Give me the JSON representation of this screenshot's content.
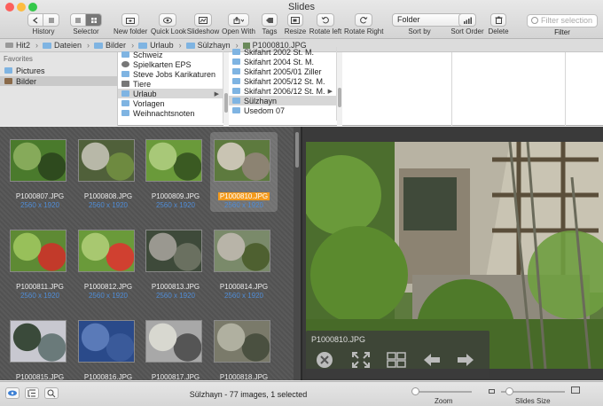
{
  "window": {
    "title": "Slides"
  },
  "toolbar": {
    "history_label": "History",
    "selector_label": "Selector",
    "new_folder_label": "New folder",
    "quick_look_label": "Quick Look",
    "slideshow_label": "Slideshow",
    "open_with_label": "Open With",
    "tags_label": "Tags",
    "resize_label": "Resize",
    "rotate_left_label": "Rotate left",
    "rotate_right_label": "Rotate Right",
    "sort_by_label": "Sort by",
    "sort_by_value": "Folder",
    "sort_order_label": "Sort Order",
    "delete_label": "Delete",
    "filter_label": "Filter",
    "filter_placeholder": "Filter selection"
  },
  "path": {
    "items": [
      "Hit2",
      "Dateien",
      "Bilder",
      "Urlaub",
      "Sülzhayn",
      "P1000810.JPG"
    ]
  },
  "sidebar": {
    "header": "Favorites",
    "items": [
      {
        "label": "Pictures"
      },
      {
        "label": "Bilder"
      }
    ]
  },
  "columns": {
    "col1": [
      "Schweiz",
      "Spielkarten EPS",
      "Steve Jobs Karikaturen",
      "Tiere",
      "Urlaub",
      "Vorlagen",
      "Weihnachtsnoten"
    ],
    "col2": [
      "Skifahrt 2002 St. M.",
      "Skifahrt 2004 St. M.",
      "Skifahrt 2005/01 Ziller",
      "Skifahrt 2005/12 St. M.",
      "Skifahrt 2006/12 St. M.",
      "Sülzhayn",
      "Usedom 07"
    ]
  },
  "images": [
    {
      "name": "P1000807.JPG",
      "dims": "2560 x 1920"
    },
    {
      "name": "P1000808.JPG",
      "dims": "2560 x 1920"
    },
    {
      "name": "P1000809.JPG",
      "dims": "2560 x 1920"
    },
    {
      "name": "P1000810.JPG",
      "dims": "2560 x 1920"
    },
    {
      "name": "P1000811.JPG",
      "dims": "2560 x 1920"
    },
    {
      "name": "P1000812.JPG",
      "dims": "2560 x 1920"
    },
    {
      "name": "P1000813.JPG",
      "dims": "2560 x 1920"
    },
    {
      "name": "P1000814.JPG",
      "dims": "2560 x 1920"
    },
    {
      "name": "P1000815.JPG",
      "dims": ""
    },
    {
      "name": "P1000816.JPG",
      "dims": ""
    },
    {
      "name": "P1000817.JPG",
      "dims": ""
    },
    {
      "name": "P1000818.JPG",
      "dims": ""
    }
  ],
  "preview": {
    "filename": "P1000810.JPG"
  },
  "status": {
    "text": "Sülzhayn - 77 images, 1 selected",
    "zoom_label": "Zoom",
    "slides_size_label": "Slides Size"
  },
  "colors": {
    "selection": "#f39a1c",
    "dims": "#4f8cd6"
  }
}
